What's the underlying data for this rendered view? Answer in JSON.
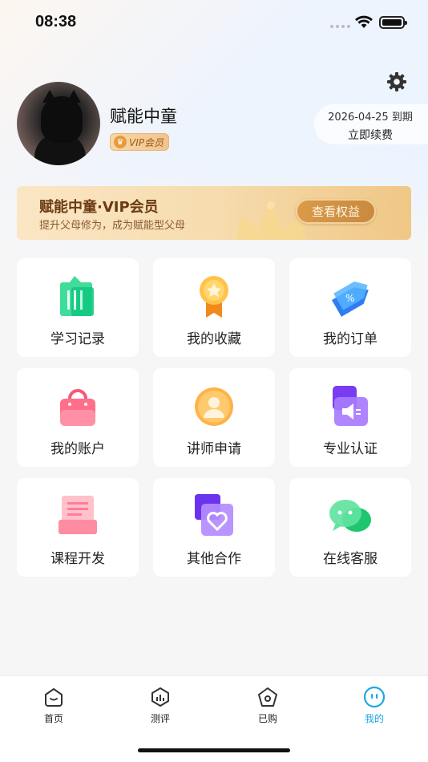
{
  "status_bar": {
    "time": "08:38"
  },
  "profile": {
    "username": "赋能中童",
    "vip_badge": "VIP会员",
    "expiry": "2026-04-25 到期",
    "renew": "立即续费"
  },
  "vip_banner": {
    "title": "赋能中童·VIP会员",
    "subtitle": "提升父母修为，成为赋能型父母",
    "button": "查看权益"
  },
  "menu": [
    {
      "label": "学习记录",
      "icon": "study-record-icon"
    },
    {
      "label": "我的收藏",
      "icon": "favorites-medal-icon"
    },
    {
      "label": "我的订单",
      "icon": "order-tag-icon"
    },
    {
      "label": "我的账户",
      "icon": "account-bag-icon"
    },
    {
      "label": "讲师申请",
      "icon": "lecturer-person-icon"
    },
    {
      "label": "专业认证",
      "icon": "certification-megaphone-icon"
    },
    {
      "label": "课程开发",
      "icon": "course-dev-icon"
    },
    {
      "label": "其他合作",
      "icon": "cooperation-heart-icon"
    },
    {
      "label": "在线客服",
      "icon": "chat-service-icon"
    }
  ],
  "tabbar": {
    "tabs": [
      {
        "label": "首页"
      },
      {
        "label": "测评"
      },
      {
        "label": "已购"
      },
      {
        "label": "我的"
      }
    ],
    "active_color": "#1ea8e0"
  }
}
